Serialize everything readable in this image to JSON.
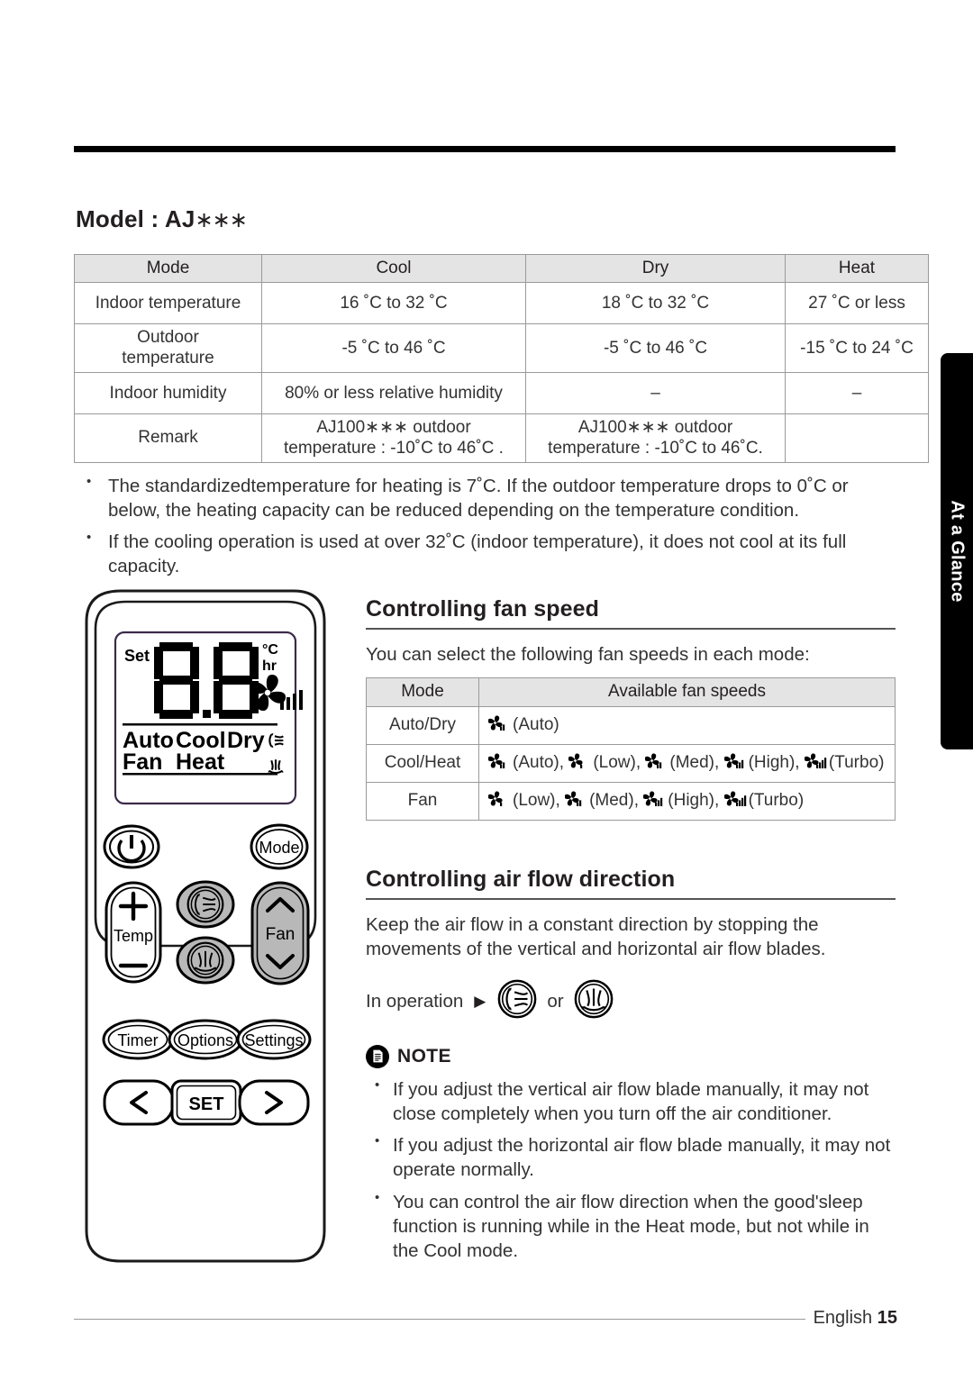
{
  "model_heading": {
    "prefix": "Model : AJ",
    "stars": "∗∗∗"
  },
  "spec_table": {
    "headers": [
      "Mode",
      "Cool",
      "Dry",
      "Heat"
    ],
    "rows": [
      {
        "label": "Indoor temperature",
        "cool": "16 ˚C to 32 ˚C",
        "dry": "18 ˚C to 32 ˚C",
        "heat": "27 ˚C or less"
      },
      {
        "label": "Outdoor\ntemperature",
        "cool": "-5 ˚C to 46 ˚C",
        "dry": "-5 ˚C to 46 ˚C",
        "heat": "-15 ˚C to 24 ˚C"
      },
      {
        "label": "Indoor humidity",
        "cool": "80% or less relative humidity",
        "dry": "–",
        "heat": "–"
      },
      {
        "label": "Remark",
        "cool": "AJ100∗∗∗ outdoor\ntemperature : -10˚C to 46˚C .",
        "dry": "AJ100∗∗∗ outdoor\ntemperature : -10˚C to 46˚C.",
        "heat": ""
      }
    ]
  },
  "spec_notes": [
    "The standardizedtemperature for heating is 7˚C. If the outdoor temperature drops to 0˚C or below, the heating capacity can be reduced depending on the temperature condition.",
    "If the cooling operation is used at over 32˚C (indoor temperature), it does not cool at its full capacity."
  ],
  "side_tab": {
    "label": "At a Glance"
  },
  "fan_speed": {
    "title": "Controlling fan speed",
    "intro": "You can select the following fan speeds in each mode:",
    "headers": [
      "Mode",
      "Available fan speeds"
    ],
    "rows": [
      {
        "mode": "Auto/Dry",
        "items": [
          {
            "bars": 2,
            "label": "(Auto)"
          }
        ],
        "sep": ""
      },
      {
        "mode": "Cool/Heat",
        "items": [
          {
            "bars": 2,
            "label": "(Auto),"
          },
          {
            "bars": 1,
            "label": "(Low),"
          },
          {
            "bars": 2,
            "label": "(Med),"
          },
          {
            "bars": 3,
            "label": "(High),"
          },
          {
            "bars": 4,
            "label": "(Turbo)"
          }
        ]
      },
      {
        "mode": "Fan",
        "items": [
          {
            "bars": 1,
            "label": "(Low),"
          },
          {
            "bars": 2,
            "label": "(Med),"
          },
          {
            "bars": 3,
            "label": "(High),"
          },
          {
            "bars": 4,
            "label": "(Turbo)"
          }
        ]
      }
    ]
  },
  "air_flow": {
    "title": "Controlling air flow direction",
    "body": "Keep the air flow in a constant direction by stopping the movements of the vertical and horizontal air flow blades.",
    "in_operation_label": "In operation",
    "or_label": "or"
  },
  "note": {
    "label": "NOTE",
    "bullets": [
      "If you adjust the vertical air flow blade manually, it may not close completely when you turn off the air conditioner.",
      "If you adjust the horizontal air flow blade manually, it may not operate normally.",
      "You can control the air flow direction when the good'sleep function is running while in the Heat mode, but not while in the Cool mode."
    ]
  },
  "footer": {
    "language": "English",
    "page": "15"
  },
  "remote": {
    "lcd": {
      "set_label": "Set",
      "digits": "88",
      "unit_c": "°C",
      "unit_hr": "hr",
      "modes_row1": [
        "Auto",
        "Cool",
        "Dry"
      ],
      "modes_row2": [
        "Fan",
        "Heat"
      ]
    },
    "buttons": {
      "power": "power-icon",
      "mode": "Mode",
      "temp": "Temp",
      "temp_up": "+",
      "temp_down": "−",
      "fan": "Fan",
      "swing_vertical": "swing-vertical-icon",
      "swing_horizontal": "swing-horizontal-icon",
      "timer": "Timer",
      "options": "Options",
      "settings": "Settings",
      "set": "SET",
      "prev": "‹",
      "next": "›"
    }
  }
}
